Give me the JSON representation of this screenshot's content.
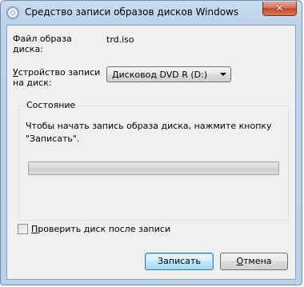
{
  "window": {
    "title": "Средство записи образов дисков Windows",
    "close_glyph": "✕"
  },
  "file": {
    "label_line1": "Файл образа",
    "label_line2": "диска:",
    "value": "trd.iso"
  },
  "device": {
    "label_line1_accel": "У",
    "label_line1_rest": "стройство записи",
    "label_line2": "на диск:",
    "selected": "Дисковод DVD R (D:)"
  },
  "status": {
    "group_title": "Состояние",
    "message_line1": "Чтобы начать запись образа диска, нажмите кнопку",
    "message_line2": "\"Записать\".",
    "progress_fraction": 0
  },
  "verify": {
    "checked": false,
    "label_accel": "П",
    "label_rest": "роверить диск после записи"
  },
  "buttons": {
    "burn_label": "Записать",
    "cancel_accel": "О",
    "cancel_rest": "тмена"
  }
}
